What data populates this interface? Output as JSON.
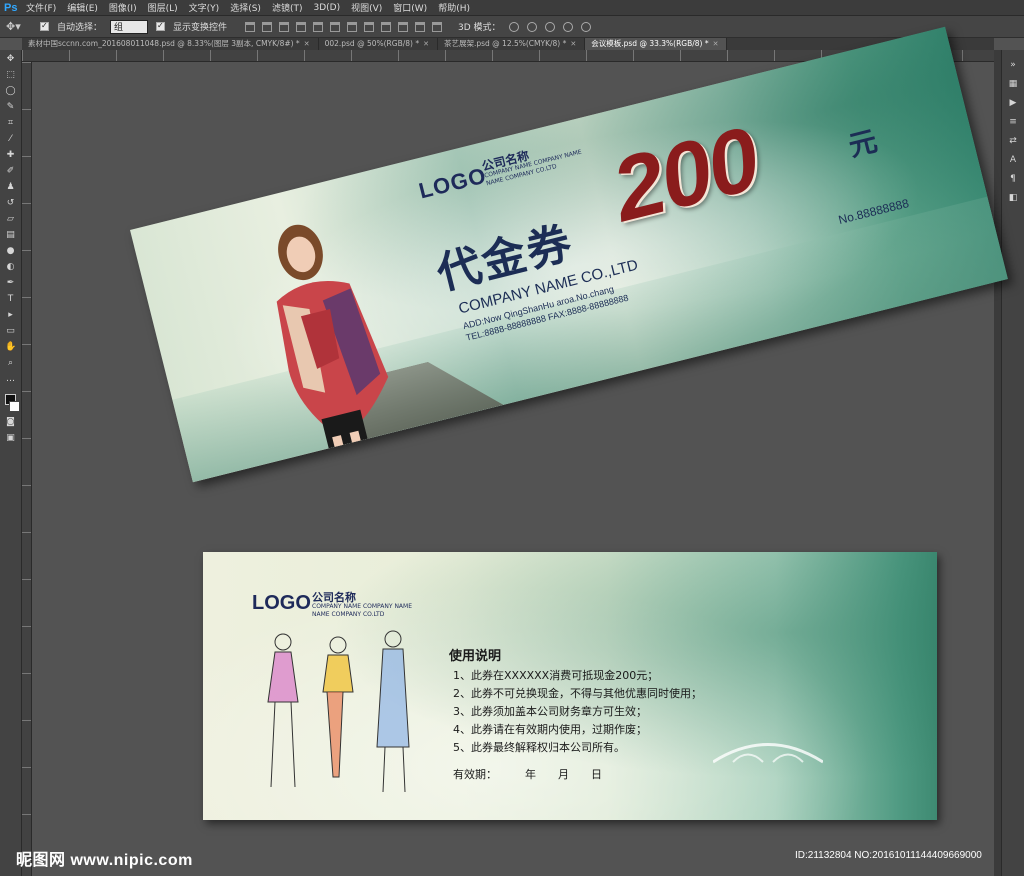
{
  "app": {
    "logo": "Ps",
    "menu": [
      "文件(F)",
      "编辑(E)",
      "图像(I)",
      "图层(L)",
      "文字(Y)",
      "选择(S)",
      "滤镜(T)",
      "3D(D)",
      "视图(V)",
      "窗口(W)",
      "帮助(H)"
    ]
  },
  "options": {
    "auto_select_label": "自动选择：",
    "auto_select_value": "组",
    "show_transform_label": "显示变换控件",
    "mode_label": "3D 模式："
  },
  "tabs": [
    {
      "label": "素材中国sccnn.com_2016080110​48.psd @ 8.33%(图层 3副本, CMYK/8#) *",
      "active": false
    },
    {
      "label": "002.psd @ 50%(RGB/8) *",
      "active": false
    },
    {
      "label": "茶艺展架.psd @ 12.5%(CMYK/8) *",
      "active": false
    },
    {
      "label": "会议模板.psd @ 33.3%(RGB/8) *",
      "active": true
    }
  ],
  "front": {
    "logo": "LOGO",
    "company_cn": "公司名称",
    "company_en_1": "COMPANY NAME COMPANY NAME",
    "company_en_2": "NAME COMPANY CO.LTD",
    "title": "代金券",
    "amount": "200",
    "unit": "元",
    "company": "COMPANY NAME CO.,LTD",
    "address": "ADD:Now QingShanHu aroa.No.chang",
    "tel": "TEL:8888-88888888   FAX:8888-88888888",
    "number": "No.88888888"
  },
  "back": {
    "logo": "LOGO",
    "company_cn": "公司名称",
    "company_en_1": "COMPANY NAME COMPANY NAME",
    "company_en_2": "NAME COMPANY CO.LTD",
    "heading": "使用说明",
    "rules": [
      "1、此券在XXXXXX消费可抵现金200元；",
      "2、此券不可兑换现金，不得与其他优惠同时使用；",
      "3、此券须加盖本公司财务章方可生效；",
      "4、此券请在有效期内使用，过期作废；",
      "5、此券最终解释权归本公司所有。"
    ],
    "validity_label": "有效期：",
    "year": "年",
    "month": "月",
    "day": "日"
  },
  "watermark": {
    "left": "昵图网 www.nipic.com",
    "right": "ID:21132804 NO:20161011144409669000"
  }
}
